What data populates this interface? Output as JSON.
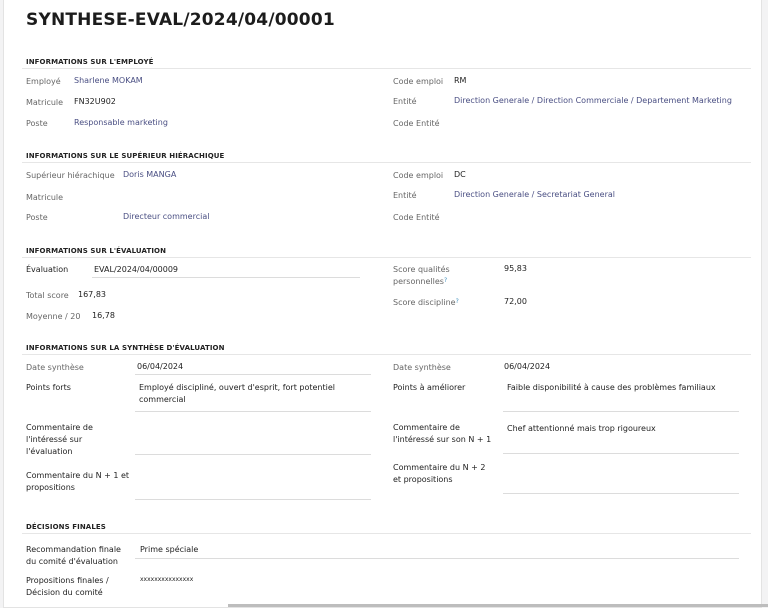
{
  "title": "SYNTHESE-EVAL/2024/04/00001",
  "employee": {
    "section": "INFORMATIONS SUR L'EMPLOYÉ",
    "employe_label": "Employé",
    "employe_value": "Sharlene MOKAM",
    "matricule_label": "Matricule",
    "matricule_value": "FN32U902",
    "poste_label": "Poste",
    "poste_value": "Responsable marketing",
    "code_emploi_label": "Code emploi",
    "code_emploi_value": "RM",
    "entite_label": "Entité",
    "entite_value": "Direction Generale / Direction Commerciale / Departement Marketing",
    "code_entite_label": "Code Entité"
  },
  "superior": {
    "section": "INFORMATIONS SUR LE SUPÉRIEUR HIÉRACHIQUE",
    "superieur_label": "Supérieur hiérachique",
    "superieur_value": "Doris MANGA",
    "matricule_label": "Matricule",
    "poste_label": "Poste",
    "poste_value": "Directeur commercial",
    "code_emploi_label": "Code emploi",
    "code_emploi_value": "DC",
    "entite_label": "Entité",
    "entite_value": "Direction Generale / Secretariat General",
    "code_entite_label": "Code Entité"
  },
  "evaluation": {
    "section": "INFORMATIONS SUR L'ÉVALUATION",
    "evaluation_label": "Évaluation",
    "evaluation_value": "EVAL/2024/04/00009",
    "total_label": "Total score",
    "total_value": "167,83",
    "moyenne_label": "Moyenne / 20",
    "moyenne_value": "16,78",
    "qualites_label_1": "Score qualités",
    "qualites_label_2": "personnelles",
    "qualites_value": "95,83",
    "discipline_label": "Score discipline",
    "discipline_value": "72,00",
    "help_mark": "?"
  },
  "synthese": {
    "section": "INFORMATIONS SUR LA SYNTHÈSE D'ÉVALUATION",
    "date_label": "Date synthèse",
    "date_value": "06/04/2024",
    "forts_label": "Points forts",
    "forts_value": "Employé discipliné, ouvert d'esprit, fort potentiel commercial",
    "comment_interesse_label": "Commentaire de l'intéressé sur l'évaluation",
    "comment_n1_label": "Commentaire du N + 1 et propositions",
    "date2_label": "Date synthèse",
    "date2_value": "06/04/2024",
    "ameliorer_label": "Points à améliorer",
    "ameliorer_value": "Faible disponibilité à cause des problèmes familiaux",
    "comment_n1_interesse_label": "Commentaire de l'intéressé sur son N + 1",
    "comment_n1_interesse_value": "Chef attentionné mais trop rigoureux",
    "comment_n2_label": "Commentaire du N + 2 et propositions"
  },
  "decisions": {
    "section": "DÉCISIONS FINALES",
    "recommandation_label": "Recommandation finale du comité d'évaluation",
    "recommandation_value": "Prime spéciale",
    "propositions_label": "Propositions finales / Décision du comité",
    "propositions_value": "xxxxxxxxxxxxxxx"
  }
}
